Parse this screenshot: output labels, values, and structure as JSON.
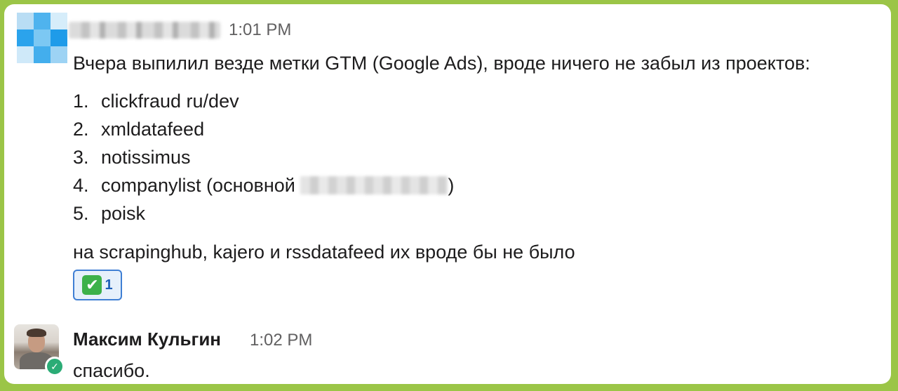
{
  "message1": {
    "time": "1:01 PM",
    "text": "Вчера выпилил везде метки GTM (Google Ads), вроде ничего не забыл из проектов:",
    "items": [
      {
        "num": "1.",
        "text": "clickfraud ru/dev"
      },
      {
        "num": "2.",
        "text": "xmldatafeed"
      },
      {
        "num": "3.",
        "text": "notissimus"
      },
      {
        "num": "4.",
        "text": "companylist (основной ",
        "suffix": ")"
      },
      {
        "num": "5.",
        "text": "poisk"
      }
    ],
    "footer": "на scrapinghub, kajero и rssdatafeed их вроде бы не было",
    "reaction": {
      "emoji": "✔",
      "count": "1",
      "icon": "white-check-mark-icon"
    }
  },
  "message2": {
    "author": "Максим Кульгин",
    "time": "1:02 PM",
    "text": "спасибо.",
    "status_icon": "online-check-icon"
  },
  "colors": {
    "background": "#9bc547",
    "reaction_border": "#3f7fd4",
    "reaction_bg": "#e6f0fb",
    "online": "#2bac76"
  }
}
